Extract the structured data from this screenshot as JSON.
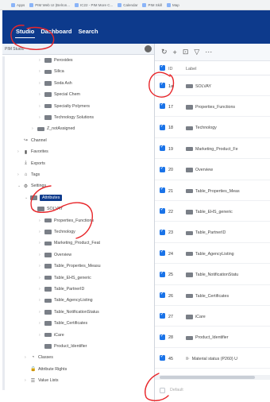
{
  "bookmarks": [
    {
      "label": "Apps"
    },
    {
      "label": "PIM Web UI (Belron..."
    },
    {
      "label": "IC22 - PIM More C..."
    },
    {
      "label": "Calendar"
    },
    {
      "label": "PIM Skill"
    },
    {
      "label": "Map"
    }
  ],
  "topnav": {
    "items": [
      "Studio",
      "Dashboard",
      "Search"
    ],
    "active": "Studio"
  },
  "left_panel": {
    "title": "PIM Studio",
    "tree": [
      {
        "label": "Peroxides",
        "level": 4,
        "type": "folder",
        "arrow": "›"
      },
      {
        "label": "Silica",
        "level": 4,
        "type": "folder",
        "arrow": "›"
      },
      {
        "label": "Soda Ash",
        "level": 4,
        "type": "folder",
        "arrow": "›"
      },
      {
        "label": "Special Chem",
        "level": 4,
        "type": "folder",
        "arrow": "›"
      },
      {
        "label": "Specialty Polymers",
        "level": 4,
        "type": "folder",
        "arrow": "›"
      },
      {
        "label": "Technology Solutions",
        "level": 4,
        "type": "folder",
        "arrow": "›"
      },
      {
        "label": "Z_notAssigned",
        "level": 3,
        "type": "folder",
        "arrow": "›"
      },
      {
        "label": "Channel",
        "level": 1,
        "type": "icon",
        "icon": "↪",
        "icon_name": "channel-icon",
        "arrow": ""
      },
      {
        "label": "Favorites",
        "level": 1,
        "type": "icon",
        "icon": "▮",
        "icon_name": "bookmark-icon",
        "arrow": "›"
      },
      {
        "label": "Exports",
        "level": 1,
        "type": "icon",
        "icon": "⤓",
        "icon_name": "export-icon",
        "arrow": ""
      },
      {
        "label": "Tags",
        "level": 1,
        "type": "icon",
        "icon": "⌂",
        "icon_name": "tag-icon",
        "arrow": "›"
      },
      {
        "label": "Settings",
        "level": 1,
        "type": "icon",
        "icon": "⚙",
        "icon_name": "gear-icon",
        "arrow": "⌄"
      },
      {
        "label": "Attributes",
        "level": 2,
        "type": "folder",
        "arrow": "⌄",
        "selected": true
      },
      {
        "label": "SOLVAY",
        "level": 3,
        "type": "folder",
        "arrow": "⌄"
      },
      {
        "label": "Properties_Functions",
        "level": 4,
        "type": "folder",
        "arrow": "›"
      },
      {
        "label": "Technology",
        "level": 4,
        "type": "folder",
        "arrow": "›"
      },
      {
        "label": "Marketing_Product_Feat",
        "level": 4,
        "type": "folder",
        "arrow": "›"
      },
      {
        "label": "Overview",
        "level": 4,
        "type": "folder",
        "arrow": "›"
      },
      {
        "label": "Table_Properties_Measu",
        "level": 4,
        "type": "folder",
        "arrow": "›"
      },
      {
        "label": "Table_EHS_generic",
        "level": 4,
        "type": "folder",
        "arrow": "›"
      },
      {
        "label": "Table_PartnerID",
        "level": 4,
        "type": "folder",
        "arrow": "›"
      },
      {
        "label": "Table_AgencyListing",
        "level": 4,
        "type": "folder",
        "arrow": "›"
      },
      {
        "label": "Table_NotificationStatus",
        "level": 4,
        "type": "folder",
        "arrow": "›"
      },
      {
        "label": "Table_Certificates",
        "level": 4,
        "type": "folder",
        "arrow": "›"
      },
      {
        "label": "iCare",
        "level": 4,
        "type": "folder",
        "arrow": "›"
      },
      {
        "label": "Product_Identifier",
        "level": 4,
        "type": "folder",
        "arrow": ""
      },
      {
        "label": "Classes",
        "level": 2,
        "type": "icon",
        "icon": "◔",
        "icon_name": "classes-icon",
        "arrow": "›"
      },
      {
        "label": "Attribute Rights",
        "level": 2,
        "type": "icon",
        "icon": "🔒",
        "icon_name": "lock-icon",
        "arrow": ""
      },
      {
        "label": "Value Lists",
        "level": 2,
        "type": "icon",
        "icon": "☰",
        "icon_name": "list-icon",
        "arrow": "›"
      }
    ]
  },
  "right_panel": {
    "toolbar": {
      "refresh": "↻",
      "add": "+",
      "folder": "⊡",
      "filter": "▽",
      "more": "⋯"
    },
    "columns": {
      "id": "ID",
      "label": "Label"
    },
    "rows": [
      {
        "id": "1a",
        "label": "SOLVAY",
        "kind": "folder"
      },
      {
        "id": "17",
        "label": "Properties_Functions",
        "kind": "folder"
      },
      {
        "id": "18",
        "label": "Technology",
        "kind": "folder"
      },
      {
        "id": "19",
        "label": "Marketing_Product_Fe",
        "kind": "folder"
      },
      {
        "id": "20",
        "label": "Overview",
        "kind": "folder"
      },
      {
        "id": "21",
        "label": "Table_Properties_Meas",
        "kind": "folder"
      },
      {
        "id": "22",
        "label": "Table_EHS_generic",
        "kind": "folder"
      },
      {
        "id": "23",
        "label": "Table_PartnerID",
        "kind": "folder"
      },
      {
        "id": "24",
        "label": "Table_AgencyListing",
        "kind": "folder"
      },
      {
        "id": "25",
        "label": "Table_NotificationStatu",
        "kind": "folder"
      },
      {
        "id": "26",
        "label": "Table_Certificates",
        "kind": "folder"
      },
      {
        "id": "27",
        "label": "iCare",
        "kind": "folder"
      },
      {
        "id": "28",
        "label": "Product_Identifier",
        "kind": "folder"
      },
      {
        "id": "45",
        "label": "Material status (P260) U",
        "kind": "attribute"
      }
    ],
    "footer_label": "Default"
  },
  "colors": {
    "nav_bg": "#0d3a8c",
    "checkbox": "#1a73e8",
    "annotation": "#e8262a"
  }
}
